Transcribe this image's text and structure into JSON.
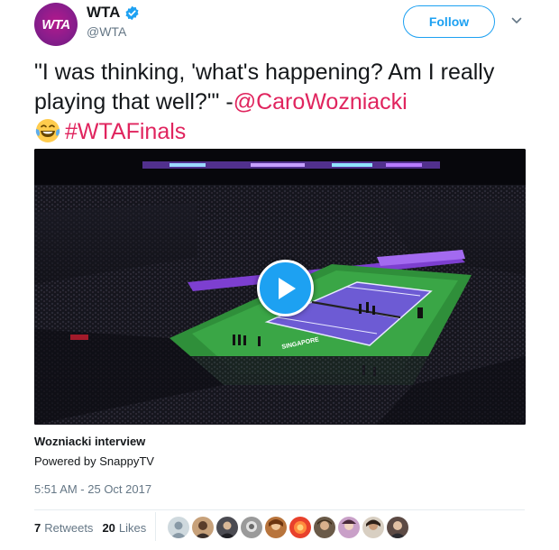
{
  "author": {
    "display_name": "WTA",
    "handle": "@WTA",
    "avatar_text": "WTA",
    "verified": true
  },
  "actions": {
    "follow_label": "Follow",
    "menu_icon": "chevron-down-icon"
  },
  "tweet": {
    "text_part1": "\"I was thinking, 'what's happening? Am I really playing that well?'\" -",
    "mention": "@CaroWozniacki",
    "emoji": "face-with-tears-of-joy",
    "hashtag": "#WTAFinals"
  },
  "media": {
    "type": "video",
    "scene": "indoor-tennis-arena",
    "court_text": "SINGAPORE"
  },
  "card": {
    "title": "Wozniacki interview",
    "subtitle": "Powered by SnappyTV"
  },
  "timestamp": "5:51 AM - 25 Oct 2017",
  "stats": {
    "retweets_count": "7",
    "retweets_label": "Retweets",
    "likes_count": "20",
    "likes_label": "Likes",
    "liker_avatars": 10
  },
  "colors": {
    "accent": "#1da1f2",
    "link": "#e0245e",
    "secondary_text": "#657786",
    "brand": "#a31a8c"
  }
}
